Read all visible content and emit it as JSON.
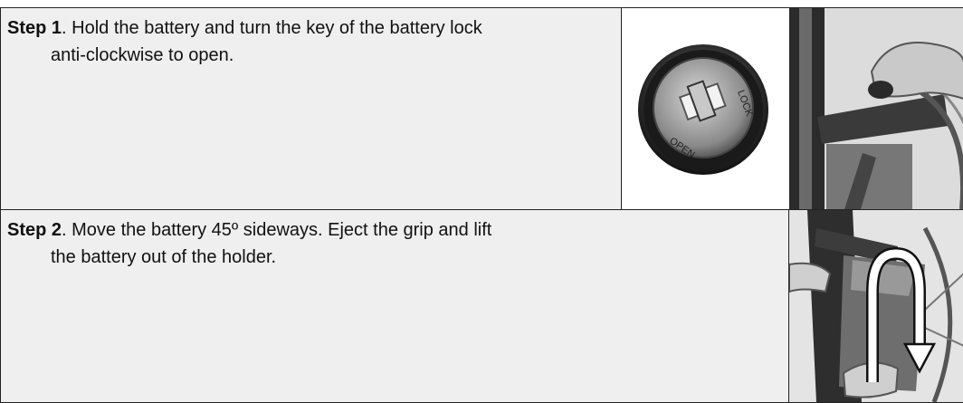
{
  "steps": [
    {
      "label": "Step 1",
      "line1": ". Hold the battery and turn the key of the battery lock",
      "line2": "anti-clockwise to open."
    },
    {
      "label": "Step 2",
      "line1": ". Move the battery 45º sideways. Eject the grip and lift",
      "line2": "the battery out of the holder."
    }
  ],
  "lock_text": {
    "top": "LOCK",
    "bottom": "OPEN"
  }
}
